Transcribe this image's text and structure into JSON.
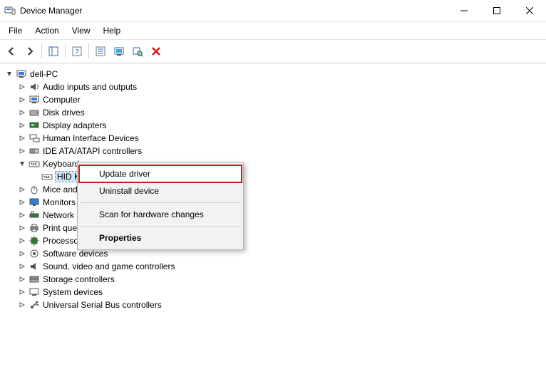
{
  "window": {
    "title": "Device Manager"
  },
  "menus": {
    "file": "File",
    "action": "Action",
    "view": "View",
    "help": "Help"
  },
  "tree": {
    "root": "dell-PC",
    "categories": [
      {
        "label": "Audio inputs and outputs",
        "icon": "audio"
      },
      {
        "label": "Computer",
        "icon": "computer"
      },
      {
        "label": "Disk drives",
        "icon": "disk"
      },
      {
        "label": "Display adapters",
        "icon": "display"
      },
      {
        "label": "Human Interface Devices",
        "icon": "hid"
      },
      {
        "label": "IDE ATA/ATAPI controllers",
        "icon": "ide"
      },
      {
        "label": "Keyboards",
        "icon": "keyboard",
        "expanded": true,
        "children": [
          {
            "label": "HID Keyboard Device",
            "icon": "keyboard",
            "selected": true,
            "truncated": "HID Ke"
          }
        ]
      },
      {
        "label": "Mice and other pointing devices",
        "icon": "mouse",
        "truncated": "Mice and"
      },
      {
        "label": "Monitors",
        "icon": "monitor",
        "truncated": "Monitors"
      },
      {
        "label": "Network adapters",
        "icon": "network",
        "truncated": "Network a"
      },
      {
        "label": "Print queues",
        "icon": "printer",
        "truncated": "Print queu"
      },
      {
        "label": "Processors",
        "icon": "processor",
        "truncated": "Processor"
      },
      {
        "label": "Software devices",
        "icon": "software"
      },
      {
        "label": "Sound, video and game controllers",
        "icon": "sound"
      },
      {
        "label": "Storage controllers",
        "icon": "storage"
      },
      {
        "label": "System devices",
        "icon": "system"
      },
      {
        "label": "Universal Serial Bus controllers",
        "icon": "usb"
      }
    ]
  },
  "context_menu": {
    "update_driver": "Update driver",
    "uninstall_device": "Uninstall device",
    "scan": "Scan for hardware changes",
    "properties": "Properties"
  }
}
